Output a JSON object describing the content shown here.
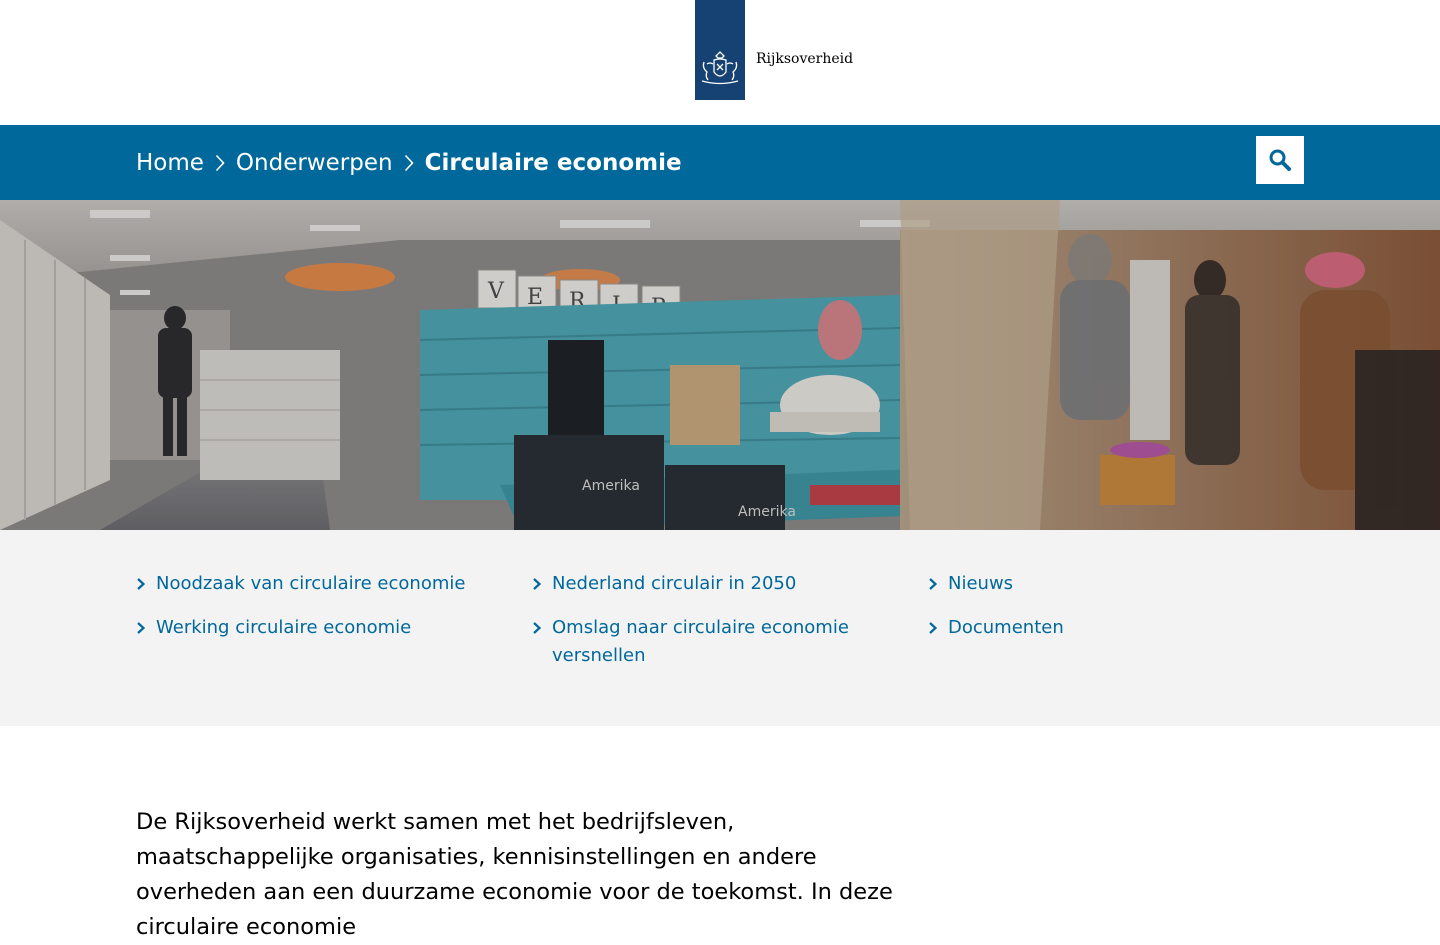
{
  "header": {
    "logo_text": "Rijksoverheid",
    "logo_bg": "#154273"
  },
  "breadcrumb": {
    "items": [
      {
        "label": "Home"
      },
      {
        "label": "Onderwerpen"
      },
      {
        "label": "Circulaire economie"
      }
    ],
    "bar_color": "#01689b",
    "search_icon": "search-icon"
  },
  "hero": {
    "description_icon": "photo"
  },
  "links": {
    "columns": [
      [
        "Noodzaak van circulaire economie",
        "Werking circulaire economie"
      ],
      [
        "Nederland circulair in 2050",
        "Omslag naar circulaire economie versnellen"
      ],
      [
        "Nieuws",
        "Documenten"
      ]
    ],
    "link_color": "#01689b"
  },
  "intro": {
    "text": "De Rijksoverheid werkt samen met het bedrijfsleven, maatschappelijke organisaties, kennisinstellingen en andere overheden aan een duurzame economie voor de toekomst. In deze circulaire economie"
  }
}
